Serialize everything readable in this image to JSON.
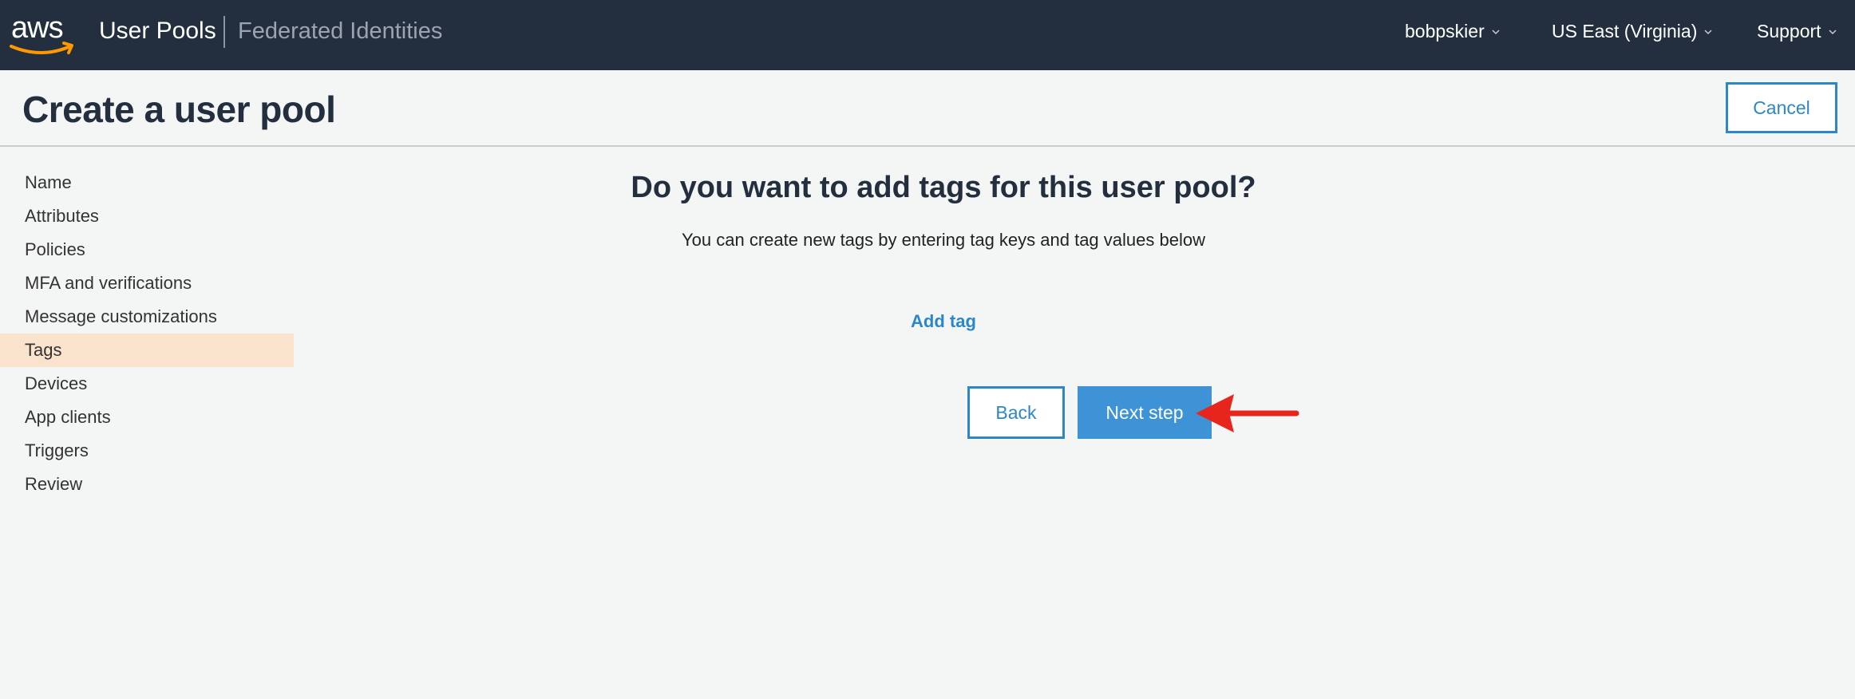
{
  "topbar": {
    "logo_text": "aws",
    "nav_primary": "User Pools",
    "nav_secondary": "Federated Identities",
    "user_menu": "bobpskier",
    "region_menu": "US East (Virginia)",
    "support_menu": "Support"
  },
  "header": {
    "title": "Create a user pool",
    "cancel_label": "Cancel"
  },
  "sidebar": {
    "items": [
      {
        "label": "Name"
      },
      {
        "label": "Attributes"
      },
      {
        "label": "Policies"
      },
      {
        "label": "MFA and verifications"
      },
      {
        "label": "Message customizations"
      },
      {
        "label": "Tags",
        "active": true
      },
      {
        "label": "Devices"
      },
      {
        "label": "App clients"
      },
      {
        "label": "Triggers"
      },
      {
        "label": "Review"
      }
    ]
  },
  "main": {
    "question": "Do you want to add tags for this user pool?",
    "subtext": "You can create new tags by entering tag keys and tag values below",
    "add_tag_label": "Add tag",
    "back_label": "Back",
    "next_label": "Next step"
  },
  "colors": {
    "topbar_bg": "#232f3e",
    "accent_blue": "#2b87c8",
    "primary_button": "#3d93d6",
    "active_nav_bg": "#fae3cc",
    "aws_orange": "#ff9900",
    "annotation_arrow": "#e8251d"
  },
  "icons": {
    "logo": "aws-smile-logo",
    "dropdown": "chevron-down-icon",
    "annotation": "red-arrow-annotation"
  }
}
